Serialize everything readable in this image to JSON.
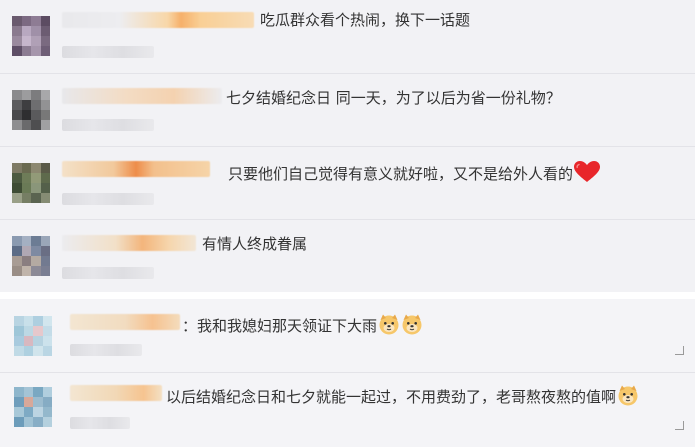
{
  "comments": [
    {
      "text": "吃瓜群众看个热闹，换下一话题",
      "emoji": null,
      "avatar_colors": [
        "#6a5a6e",
        "#7c6a82",
        "#8e7c94",
        "#5c4c62",
        "#8a7a8e",
        "#b8a8c0",
        "#a090a8",
        "#6c5c72",
        "#9a8a9e",
        "#c6b6cc",
        "#b0a0b6",
        "#7a6a80",
        "#5e4e66",
        "#8c7c92",
        "#a696ac",
        "#6e5e76"
      ]
    },
    {
      "text": "七夕结婚纪念日 同一天，为了以后为省一份礼物？",
      "emoji": null,
      "avatar_colors": [
        "#8a8a8c",
        "#9c9c9e",
        "#7c7c7e",
        "#a8a8aa",
        "#5c5c5e",
        "#3e3e40",
        "#6e6e70",
        "#929294",
        "#4a4a4c",
        "#2e2e30",
        "#5a5a5c",
        "#787878",
        "#8e8e90",
        "#6a6a6c",
        "#4e4e50",
        "#a0a0a2"
      ]
    },
    {
      "text": "只要他们自己觉得有意义就好啦，又不是给外人看的",
      "emoji": "heart",
      "avatar_colors": [
        "#7e7a64",
        "#6a6a50",
        "#8c8870",
        "#5a5a48",
        "#4c5a40",
        "#6e7c58",
        "#929a78",
        "#5e6a4c",
        "#3e4c34",
        "#6a7a56",
        "#8a967a",
        "#54604a",
        "#9aa088",
        "#767e64",
        "#5a6450",
        "#868c74"
      ]
    },
    {
      "text": "有情人终成眷属",
      "emoji": null,
      "avatar_colors": [
        "#8a9ab0",
        "#a4b0c2",
        "#6c7c94",
        "#9aa6b8",
        "#5c6c86",
        "#b0a8b4",
        "#7e8aa2",
        "#6a6e84",
        "#a89c94",
        "#8a7e80",
        "#b4aaa2",
        "#727a90",
        "#9a8e86",
        "#c0b4aa",
        "#8c8a96",
        "#7a7e92"
      ]
    },
    {
      "text": "：我和我媳妇那天领证下大雨",
      "emoji": "doge2",
      "avatar_colors": [
        "#b8d4e2",
        "#c8e0ea",
        "#aecfe0",
        "#d2e6ee",
        "#9ec6d8",
        "#bcd8e4",
        "#e6c8cc",
        "#c4dce8",
        "#a8cade",
        "#d8b8c0",
        "#b6d2e0",
        "#cce2ec",
        "#c0dae6",
        "#aed0e0",
        "#d0e4ec",
        "#bad6e4"
      ]
    },
    {
      "text": "以后结婚纪念日和七夕就能一起过，不用费劲了，老哥熬夜熬的值啊",
      "emoji": "doge1",
      "avatar_colors": [
        "#8eb6cc",
        "#a4c4d6",
        "#7aa8c2",
        "#b0cede",
        "#6f9ebc",
        "#d8a89a",
        "#9cbccf",
        "#86acc4",
        "#a8c8d8",
        "#7eaac4",
        "#bcd4e2",
        "#94b8cc",
        "#6c9cba",
        "#a0c2d4",
        "#88aec6",
        "#b4d0de"
      ]
    }
  ]
}
